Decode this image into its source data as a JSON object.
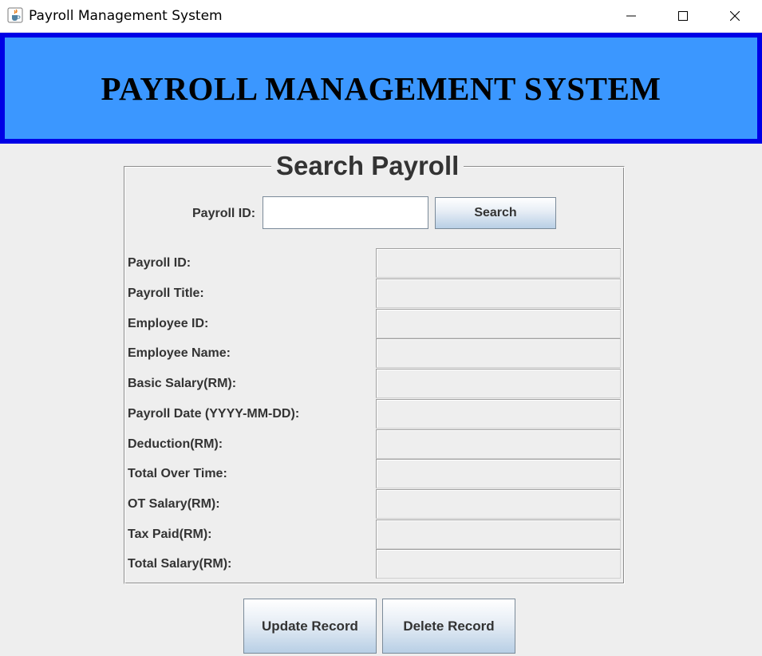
{
  "window": {
    "title": "Payroll Management System",
    "icons": [
      "java-cup-icon",
      "minimize-icon",
      "maximize-icon",
      "close-icon"
    ]
  },
  "banner": {
    "title": "PAYROLL MANAGEMENT SYSTEM"
  },
  "search": {
    "legend": "Search Payroll",
    "label": "Payroll ID:",
    "value": "",
    "button_label": "Search"
  },
  "fields": [
    {
      "label": "Payroll ID:",
      "value": ""
    },
    {
      "label": "Payroll Title:",
      "value": ""
    },
    {
      "label": "Employee ID:",
      "value": ""
    },
    {
      "label": "Employee Name:",
      "value": ""
    },
    {
      "label": "Basic Salary(RM):",
      "value": ""
    },
    {
      "label": "Payroll Date (YYYY-MM-DD):",
      "value": ""
    },
    {
      "label": "Deduction(RM):",
      "value": ""
    },
    {
      "label": "Total Over Time:",
      "value": ""
    },
    {
      "label": "OT Salary(RM):",
      "value": ""
    },
    {
      "label": "Tax Paid(RM):",
      "value": ""
    },
    {
      "label": "Total Salary(RM):",
      "value": ""
    }
  ],
  "actions": {
    "update_label": "Update Record",
    "delete_label": "Delete Record"
  },
  "colors": {
    "banner_fill": "#3b97ff",
    "banner_border": "#0000e6",
    "background": "#eeeeee"
  }
}
